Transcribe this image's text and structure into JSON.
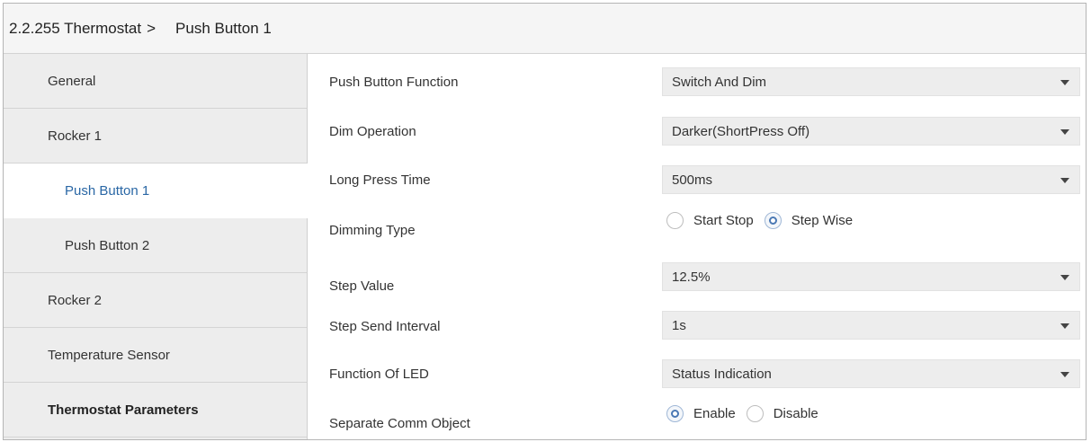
{
  "header": {
    "device": "2.2.255 Thermostat",
    "separator": ">",
    "current": "Push Button 1"
  },
  "sidebar": {
    "items": [
      {
        "label": "General"
      },
      {
        "label": "Rocker 1"
      },
      {
        "label": "Push Button 1"
      },
      {
        "label": "Push Button 2"
      },
      {
        "label": "Rocker 2"
      },
      {
        "label": "Temperature Sensor"
      },
      {
        "label": "Thermostat Parameters"
      }
    ]
  },
  "params": {
    "push_button_function": {
      "label": "Push Button Function",
      "value": "Switch And Dim"
    },
    "dim_operation": {
      "label": "Dim Operation",
      "value": "Darker(ShortPress Off)"
    },
    "long_press_time": {
      "label": "Long Press Time",
      "value": "500ms"
    },
    "dimming_type": {
      "label": "Dimming Type",
      "options": [
        "Start Stop",
        "Step Wise"
      ],
      "selected": "Step Wise"
    },
    "step_value": {
      "label": "Step Value",
      "value": "12.5%"
    },
    "step_send_interval": {
      "label": "Step Send Interval",
      "value": "1s"
    },
    "function_of_led": {
      "label": "Function Of LED",
      "value": "Status Indication"
    },
    "separate_comm_object": {
      "label": "Separate Comm Object",
      "options": [
        "Enable",
        "Disable"
      ],
      "selected": "Enable"
    }
  },
  "icons": {
    "dropdown": "chevron-down-icon",
    "radio_checked": "radio-checked-icon",
    "radio_unchecked": "radio-unchecked-icon"
  },
  "colors": {
    "active_item_text": "#2a67a5",
    "sidebar_bg": "#ededed",
    "select_bg": "#ededed",
    "radio_accent": "#4a78b4"
  }
}
